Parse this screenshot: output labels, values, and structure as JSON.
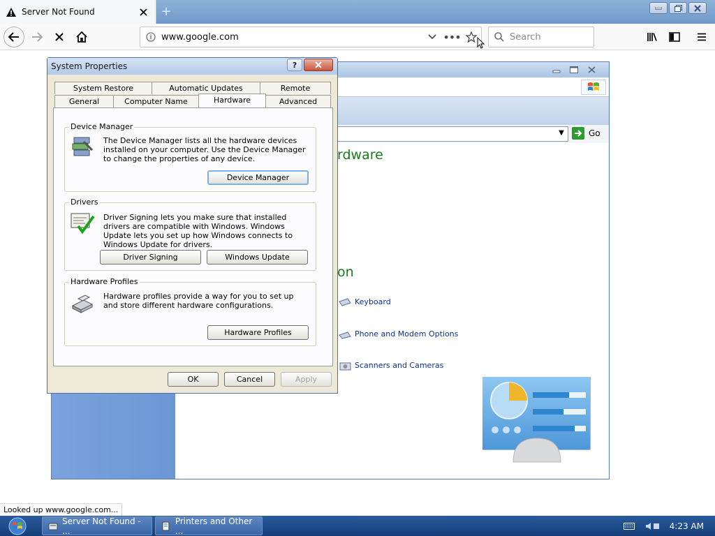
{
  "browser": {
    "tab_title": "Server Not Found",
    "url_host": "www.google.com",
    "search_placeholder": "Search",
    "status_text": "Looked up www.google.com..."
  },
  "control_panel": {
    "heading_hardware": "rdware",
    "heading_section": "on",
    "go_label": "Go",
    "links": [
      "Keyboard",
      "Phone and Modem Options",
      "Scanners and Cameras"
    ]
  },
  "dialog": {
    "title": "System Properties",
    "tabs_back": [
      "System Restore",
      "Automatic Updates",
      "Remote"
    ],
    "tabs_front": [
      "General",
      "Computer Name",
      "Hardware",
      "Advanced"
    ],
    "active_tab": "Hardware",
    "device_manager": {
      "legend": "Device Manager",
      "text": "The Device Manager lists all the hardware devices installed on your computer. Use the Device Manager to change the properties of any device.",
      "button": "Device Manager"
    },
    "drivers": {
      "legend": "Drivers",
      "text": "Driver Signing lets you make sure that installed drivers are compatible with Windows. Windows Update lets you set up how Windows connects to Windows Update for drivers.",
      "button_signing": "Driver Signing",
      "button_update": "Windows Update"
    },
    "hardware_profiles": {
      "legend": "Hardware Profiles",
      "text": "Hardware profiles provide a way for you to set up and store different hardware configurations.",
      "button": "Hardware Profiles"
    },
    "ok": "OK",
    "cancel": "Cancel",
    "apply": "Apply"
  },
  "taskbar": {
    "items": [
      "Server Not Found - ...",
      "Printers and Other ..."
    ],
    "clock": "4:23 AM"
  },
  "colors": {
    "heading_green": "#1b7c1b",
    "link_blue": "#0c2fa0",
    "taskbar": "#1f4c8f"
  }
}
